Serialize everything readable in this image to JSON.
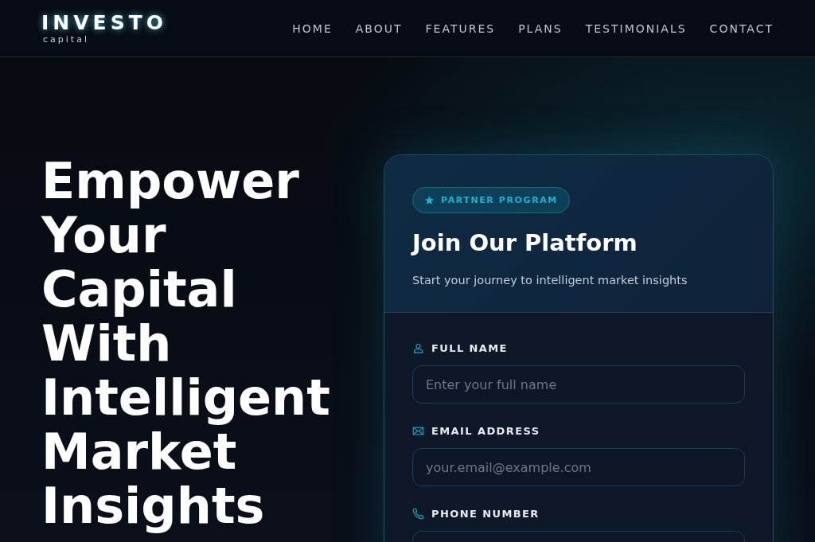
{
  "logo": {
    "name": "INVESTO",
    "tagline": "capital"
  },
  "nav": [
    {
      "label": "HOME"
    },
    {
      "label": "ABOUT"
    },
    {
      "label": "FEATURES"
    },
    {
      "label": "PLANS"
    },
    {
      "label": "TESTIMONIALS"
    },
    {
      "label": "CONTACT"
    }
  ],
  "hero": {
    "heading": "Empower Your Capital With Intelligent Market Insights"
  },
  "card": {
    "badge": "PARTNER PROGRAM",
    "title": "Join Our Platform",
    "subtitle": "Start your journey to intelligent market insights",
    "fields": [
      {
        "kind": "person",
        "label": "FULL NAME",
        "placeholder": "Enter your full name"
      },
      {
        "kind": "mail",
        "label": "EMAIL ADDRESS",
        "placeholder": "your.email@example.com"
      },
      {
        "kind": "phone",
        "label": "PHONE NUMBER"
      }
    ]
  }
}
